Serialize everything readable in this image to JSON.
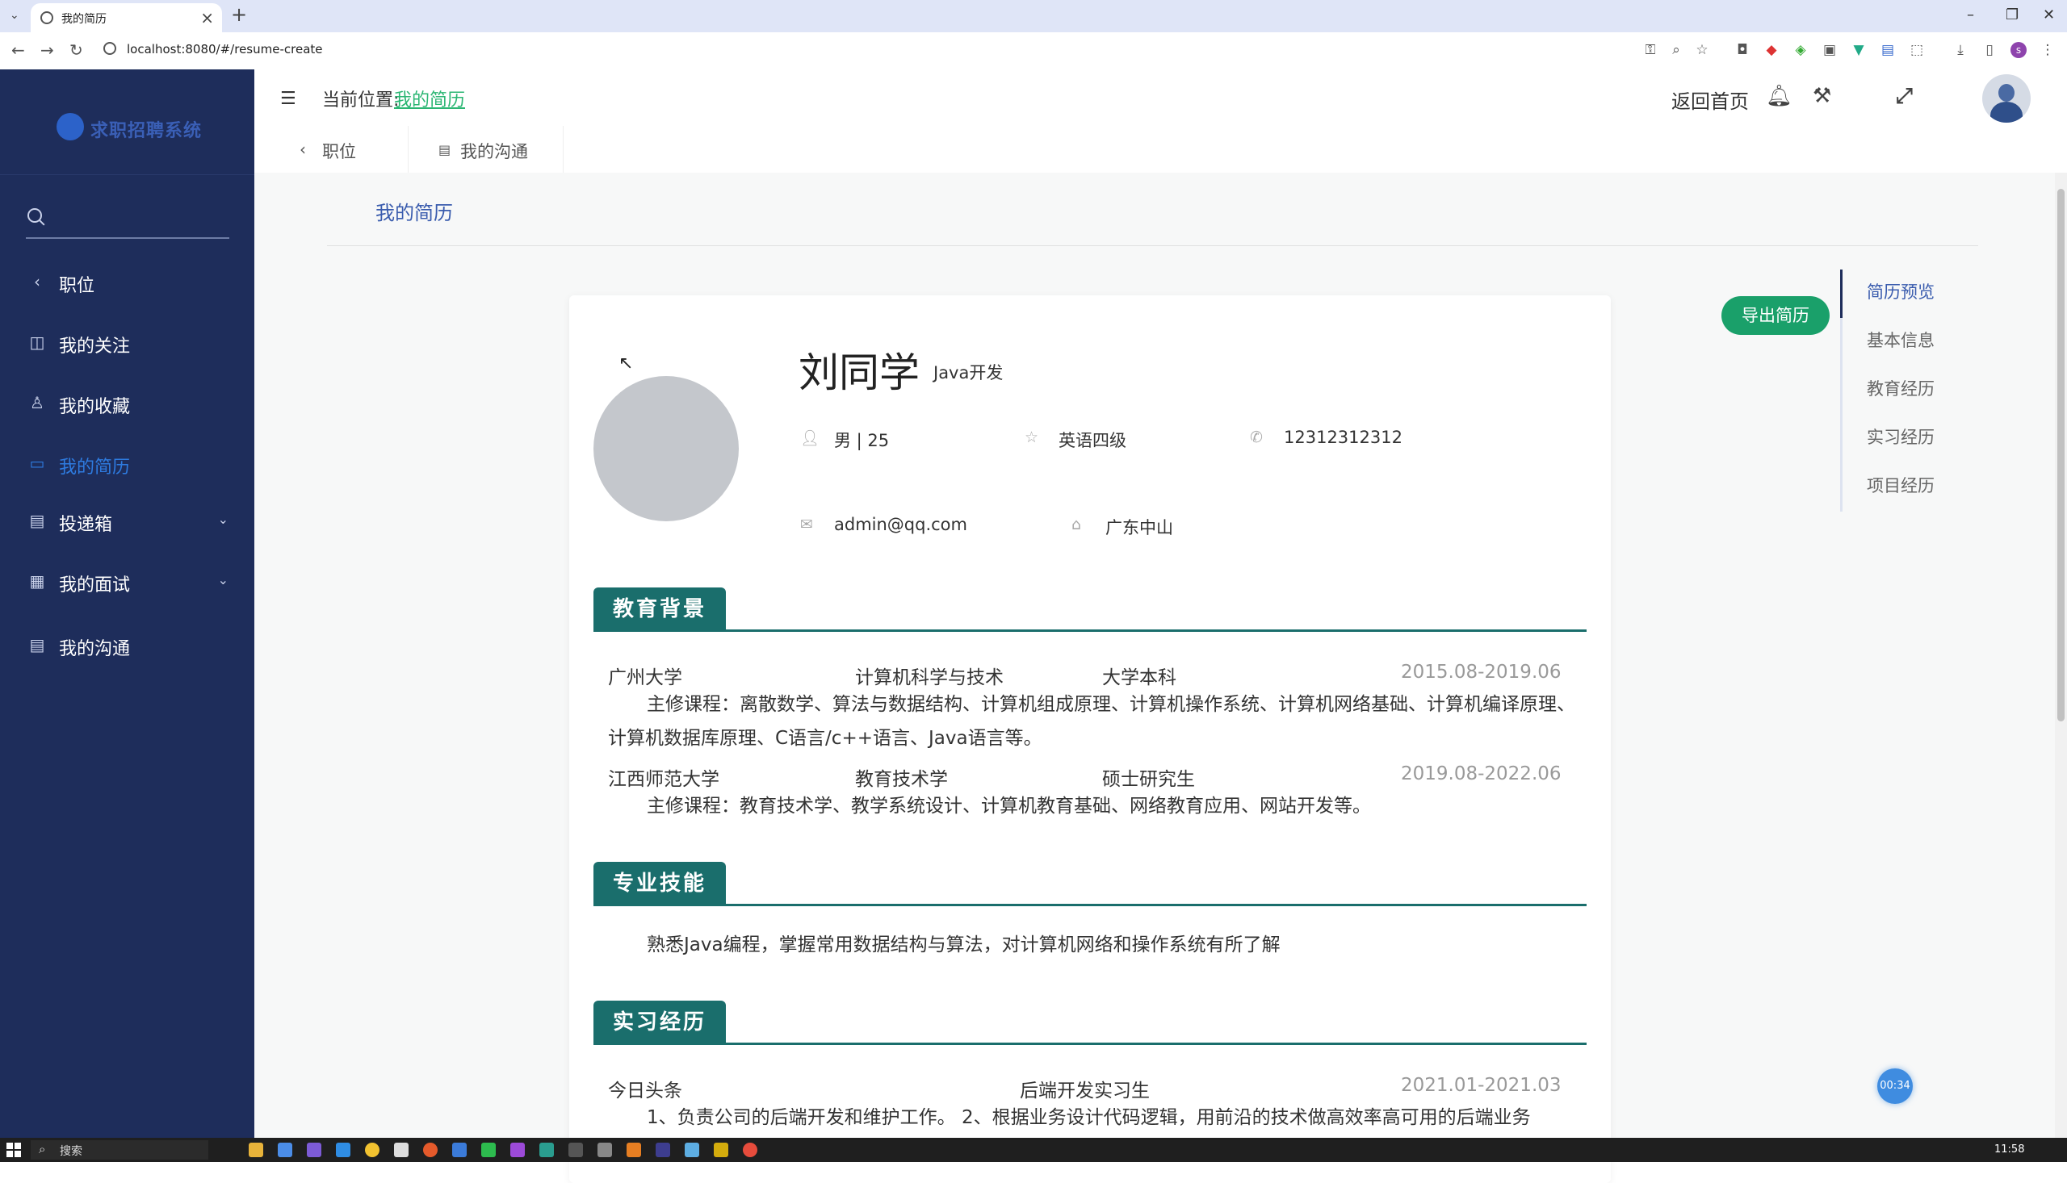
{
  "browser": {
    "tab_title": "我的简历",
    "url": "localhost:8080/#/resume-create"
  },
  "sidebar": {
    "logo_text": "求职招聘系统",
    "items": [
      {
        "label": "职位",
        "icon": "chevron-left-icon"
      },
      {
        "label": "我的关注",
        "icon": "bag-icon"
      },
      {
        "label": "我的收藏",
        "icon": "user-icon"
      },
      {
        "label": "我的简历",
        "icon": "folder-icon",
        "active": true
      },
      {
        "label": "投递箱",
        "icon": "box-icon",
        "expandable": true
      },
      {
        "label": "我的面试",
        "icon": "briefcase-icon",
        "expandable": true
      },
      {
        "label": "我的沟通",
        "icon": "chat-icon"
      }
    ]
  },
  "header": {
    "crumb_label": "当前位置:",
    "crumb_link": "我的简历",
    "home_link": "返回首页"
  },
  "page_tabs": [
    {
      "label": "职位",
      "icon": "chevron-left-icon"
    },
    {
      "label": "我的沟通",
      "icon": "chat-icon"
    }
  ],
  "page": {
    "heading": "我的简历",
    "export_button": "导出简历"
  },
  "toc": [
    "简历预览",
    "基本信息",
    "教育经历",
    "实习经历",
    "项目经历"
  ],
  "resume": {
    "name": "刘同学",
    "job": "Java开发",
    "gender_age": "男 | 25",
    "english": "英语四级",
    "phone": "12312312312",
    "email": "admin@qq.com",
    "location": "广东中山",
    "sections": {
      "education": "教育背景",
      "skills": "专业技能",
      "internship": "实习经历"
    },
    "education": [
      {
        "school": "广州大学",
        "major": "计算机科学与技术",
        "degree": "大学本科",
        "date": "2015.08-2019.06",
        "courses": "主修课程：离散数学、算法与数据结构、计算机组成原理、计算机操作系统、计算机网络基础、计算机编译原理、计算机数据库原理、C语言/c++语言、Java语言等。"
      },
      {
        "school": "江西师范大学",
        "major": "教育技术学",
        "degree": "硕士研究生",
        "date": "2019.08-2022.06",
        "courses": "主修课程：教育技术学、教学系统设计、计算机教育基础、网络教育应用、网站开发等。"
      }
    ],
    "skills": "熟悉Java编程，掌握常用数据结构与算法，对计算机网络和操作系统有所了解",
    "internship": {
      "company": "今日头条",
      "role": "后端开发实习生",
      "date": "2021.01-2021.03",
      "desc": "1、负责公司的后端开发和维护工作。 2、根据业务设计代码逻辑，用前沿的技术做高效率高可用的后端业务"
    }
  },
  "timer": "00:34",
  "taskbar": {
    "search_label": "搜索",
    "clock": "11:58"
  }
}
